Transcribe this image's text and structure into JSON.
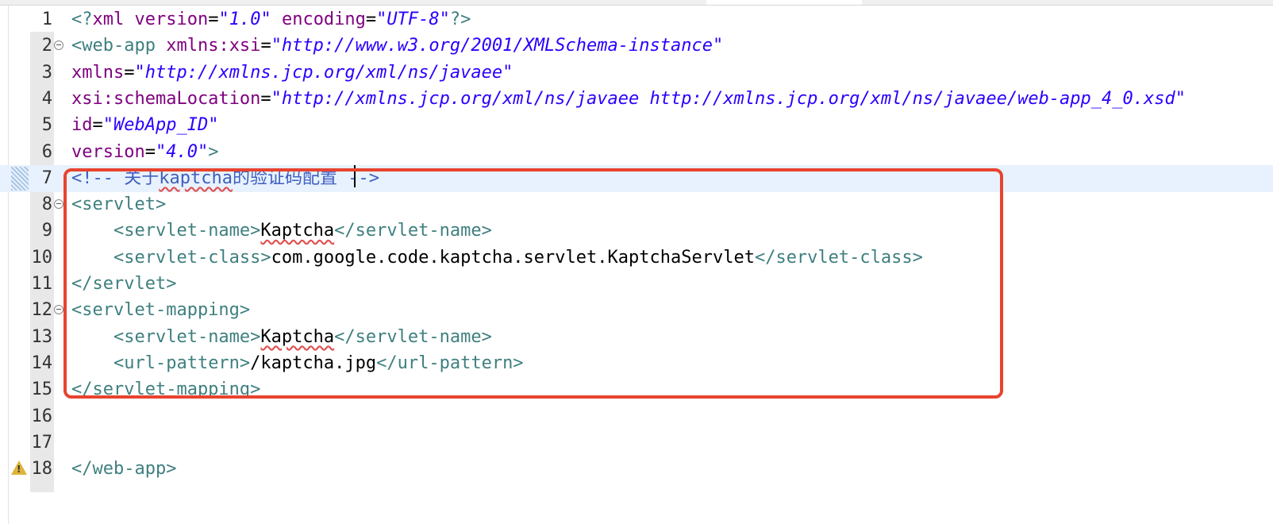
{
  "editor": {
    "highlight_color": "#e8432f",
    "current_line": 7,
    "lines": [
      {
        "num": "1"
      },
      {
        "num": "2",
        "fold": true
      },
      {
        "num": "3"
      },
      {
        "num": "4"
      },
      {
        "num": "5"
      },
      {
        "num": "6"
      },
      {
        "num": "7",
        "current": true,
        "marker": true
      },
      {
        "num": "8",
        "fold": true
      },
      {
        "num": "9"
      },
      {
        "num": "10"
      },
      {
        "num": "11"
      },
      {
        "num": "12",
        "fold": true
      },
      {
        "num": "13"
      },
      {
        "num": "14"
      },
      {
        "num": "15"
      },
      {
        "num": "16"
      },
      {
        "num": "17"
      },
      {
        "num": "18",
        "warning": true
      }
    ],
    "code": {
      "l1": {
        "open": "<?",
        "name": "xml",
        "a1": "version",
        "v1": "\"1.0\"",
        "a2": "encoding",
        "v2": "\"UTF-8\"",
        "close": "?>"
      },
      "l2": {
        "open": "<",
        "name": "web-app",
        "attr": "xmlns:xsi",
        "value": "\"http://www.w3.org/2001/XMLSchema-instance\""
      },
      "l3": {
        "attr": "xmlns",
        "value": "\"http://xmlns.jcp.org/xml/ns/javaee\""
      },
      "l4": {
        "attr": "xsi:schemaLocation",
        "value": "\"http://xmlns.jcp.org/xml/ns/javaee http://xmlns.jcp.org/xml/ns/javaee/web-app_4_0.xsd\""
      },
      "l5": {
        "attr": "id",
        "value": "\"WebApp_ID\""
      },
      "l6": {
        "attr": "version",
        "value": "\"4.0\"",
        "close": ">"
      },
      "l7": {
        "comment_start": "<!-- 关于",
        "comment_word": "kaptcha",
        "comment_rest": "的验证码配置",
        "comment_end": " -->"
      },
      "l8": {
        "tag": "<servlet>"
      },
      "l9": {
        "indent": "    ",
        "open": "<servlet-name>",
        "text": "Kaptcha",
        "close": "</servlet-name>"
      },
      "l10": {
        "indent": "    ",
        "open": "<servlet-class>",
        "text": "com.google.code.kaptcha.servlet.KaptchaServlet",
        "close": "</servlet-class>"
      },
      "l11": {
        "tag": "</servlet>"
      },
      "l12": {
        "tag": "<servlet-mapping>"
      },
      "l13": {
        "indent": "    ",
        "open": "<servlet-name>",
        "text": "Kaptcha",
        "close": "</servlet-name>"
      },
      "l14": {
        "indent": "    ",
        "open": "<url-pattern>",
        "text": "/kaptcha.jpg",
        "close": "</url-pattern>"
      },
      "l15": {
        "tag": "</servlet-mapping>"
      },
      "l18": {
        "tag": "</web-app>"
      }
    }
  }
}
